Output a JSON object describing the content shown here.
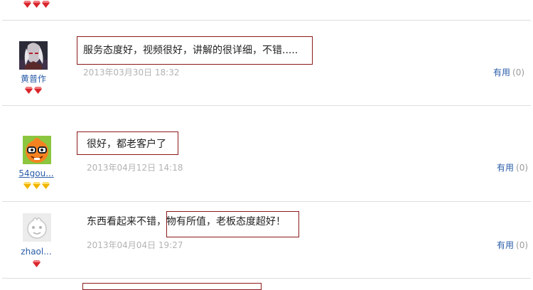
{
  "reviews": [
    {
      "username": "黄普作",
      "comment": "服务态度好，视频很好，讲解的很详细，不错.....",
      "date": "2013年03月30日 18:32",
      "useful_label": "有用",
      "useful_count": "(0)",
      "badge_icon": "red-diamond-icon",
      "badge_count": 2
    },
    {
      "username": "54gou...",
      "comment": "很好，都老客户了",
      "date": "2013年04月12日 14:18",
      "useful_label": "有用",
      "useful_count": "(0)",
      "badge_icon": "yellow-diamond-icon",
      "badge_count": 3
    },
    {
      "username": "zhaol...",
      "comment": "东西看起来不错，物有所值，老板态度超好！",
      "date": "2013年04月04日 19:27",
      "useful_label": "有用",
      "useful_count": "(0)",
      "badge_icon": "red-diamond-icon",
      "badge_count": 1
    }
  ],
  "colors": {
    "link": "#2a5ca8",
    "highlight_border": "#8b1a1a",
    "date": "#b3b3b3",
    "divider": "#dedede",
    "red_gem": "#d9262c",
    "yellow_gem": "#f0b400"
  }
}
